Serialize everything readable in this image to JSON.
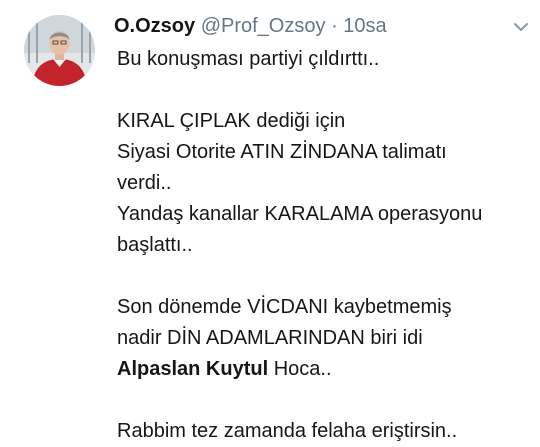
{
  "tweet": {
    "display_name": "O.Ozsoy",
    "handle": "@Prof_Ozsoy",
    "separator": "·",
    "time": "10sa",
    "lines": {
      "l1": "Bu konuşması partiyi çıldırttı..",
      "l2": "KIRAL ÇIPLAK dediği için",
      "l3": "Siyasi Otorite ATIN ZİNDANA talimatı",
      "l4": "verdi..",
      "l5": "Yandaş kanallar KARALAMA operasyonu",
      "l6": "başlattı..",
      "l7": "Son dönemde VİCDANI kaybetmemiş",
      "l8": "nadir DİN ADAMLARINDAN biri idi",
      "l9_bold": "Alpaslan Kuytul",
      "l9_rest": " Hoca..",
      "l10": "Rabbim tez zamanda felaha eriştirsin.."
    }
  },
  "icons": {
    "avatar": "profile-photo",
    "menu": "chevron-down-icon"
  }
}
